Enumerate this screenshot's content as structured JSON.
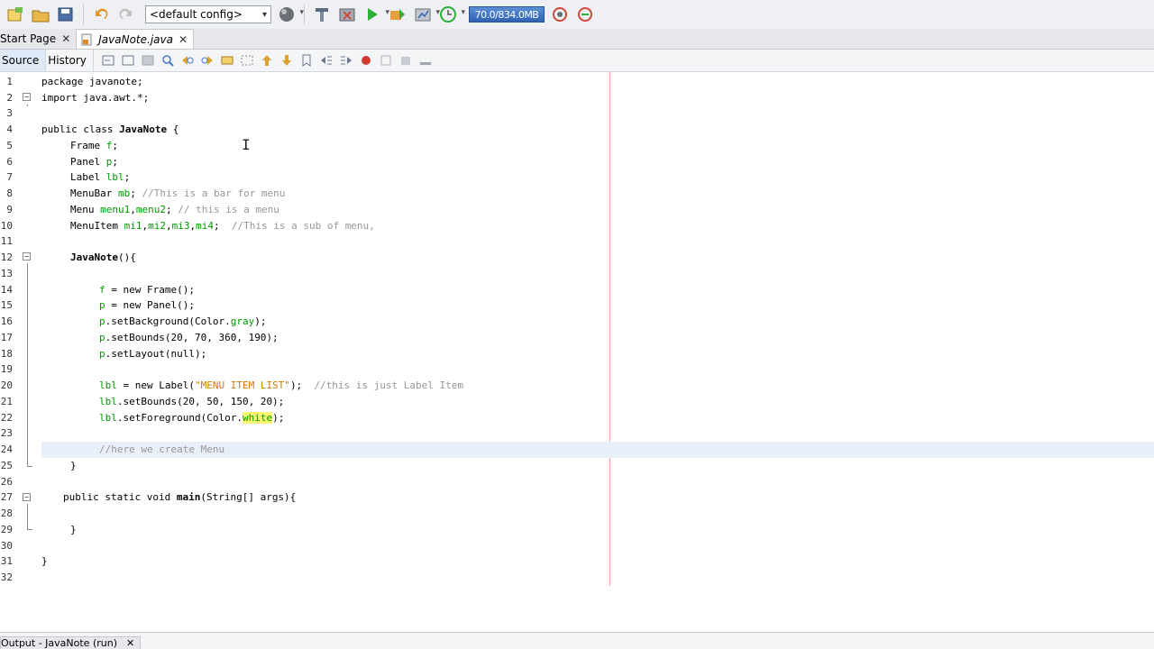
{
  "toolbar": {
    "config_label": "<default config>",
    "memory_label": "70.0/834.0MB",
    "icons": [
      "new-file-icon",
      "open-project-icon",
      "save-all-icon",
      "undo-icon",
      "redo-icon",
      "globe-icon",
      "clean-build-icon",
      "build-icon",
      "run-icon",
      "debug-icon",
      "profile-icon",
      "pause-icon",
      "gc-icon",
      "reset-icon"
    ]
  },
  "tabs": [
    {
      "label": "Start Page"
    },
    {
      "label": "JavaNote.java"
    }
  ],
  "editor_tabs": {
    "source": "Source",
    "history": "History"
  },
  "colors": {
    "field": "#009900",
    "comment": "#969696",
    "string": "#ce7b00",
    "margin": "#f0a0a0",
    "current_line": "#e9eff8"
  },
  "code": {
    "line_numbers": [
      "1",
      "2",
      "3",
      "4",
      "5",
      "6",
      "7",
      "8",
      "9",
      "10",
      "11",
      "12",
      "13",
      "14",
      "15",
      "16",
      "17",
      "18",
      "19",
      "20",
      "21",
      "22",
      "23",
      "24",
      "25",
      "26",
      "27",
      "28",
      "29",
      "30",
      "31",
      "32"
    ],
    "l1": "package javanote;",
    "l2": "import java.awt.*;",
    "l4_a": "public class ",
    "l4_b": "JavaNote",
    "l4_c": " {",
    "l5_a": "Frame ",
    "l5_b": "f",
    "l5_c": ";",
    "l6_a": "Panel ",
    "l6_b": "p",
    "l6_c": ";",
    "l7_a": "Label ",
    "l7_b": "lbl",
    "l7_c": ";",
    "l8_a": "MenuBar ",
    "l8_b": "mb",
    "l8_c": "; ",
    "l8_d": "//This is a bar for menu",
    "l9_a": "Menu ",
    "l9_b": "menu1",
    "l9_c": ",",
    "l9_d": "menu2",
    "l9_e": "; ",
    "l9_f": "// this is a menu",
    "l10_a": "MenuItem ",
    "l10_b": "mi1",
    "l10_c": ",",
    "l10_d": "mi2",
    "l10_e": ",",
    "l10_f": "mi3",
    "l10_g": ",",
    "l10_h": "mi4",
    "l10_i": ";  ",
    "l10_j": "//This is a sub of menu,",
    "l12_a": "JavaNote",
    "l12_b": "(){",
    "l14_a": "f",
    "l14_b": " = new Frame();",
    "l15_a": "p",
    "l15_b": " = new Panel();",
    "l16_a": "p",
    "l16_b": ".setBackground(Color.",
    "l16_c": "gray",
    "l16_d": ");",
    "l17_a": "p",
    "l17_b": ".setBounds(20, 70, 360, 190);",
    "l18_a": "p",
    "l18_b": ".setLayout(null);",
    "l20_a": "lbl",
    "l20_b": " = new Label(",
    "l20_c": "\"MENU ITEM LIST\"",
    "l20_d": ");  ",
    "l20_e": "//this is just Label Item",
    "l21_a": "lbl",
    "l21_b": ".setBounds(20, 50, 150, 20);",
    "l22_a": "lbl",
    "l22_b": ".setForeground(Color.",
    "l22_c": "white",
    "l22_d": ");",
    "l24": "//here we create Menu",
    "l25": "}",
    "l27_a": "public static void ",
    "l27_b": "main",
    "l27_c": "(String[] args){",
    "l29": "}",
    "l31": "}"
  },
  "output": {
    "label": "Output - JavaNote (run)"
  }
}
